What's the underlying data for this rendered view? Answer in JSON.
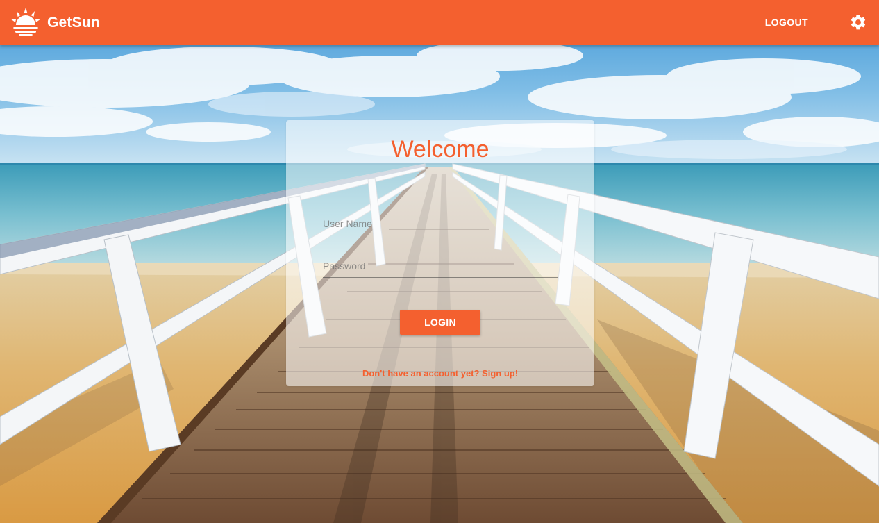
{
  "header": {
    "brand_name": "GetSun",
    "logout_label": "LOGOUT",
    "settings_icon": "gear-icon",
    "logo_icon": "sun-logo-icon",
    "background_color": "#f4602f"
  },
  "login": {
    "title": "Welcome",
    "username_placeholder": "User Name",
    "password_placeholder": "Password",
    "button_label": "LOGIN",
    "signup_link": "Don't have an account yet? Sign up!"
  },
  "colors": {
    "accent": "#f4602f",
    "text_on_accent": "#ffffff"
  }
}
